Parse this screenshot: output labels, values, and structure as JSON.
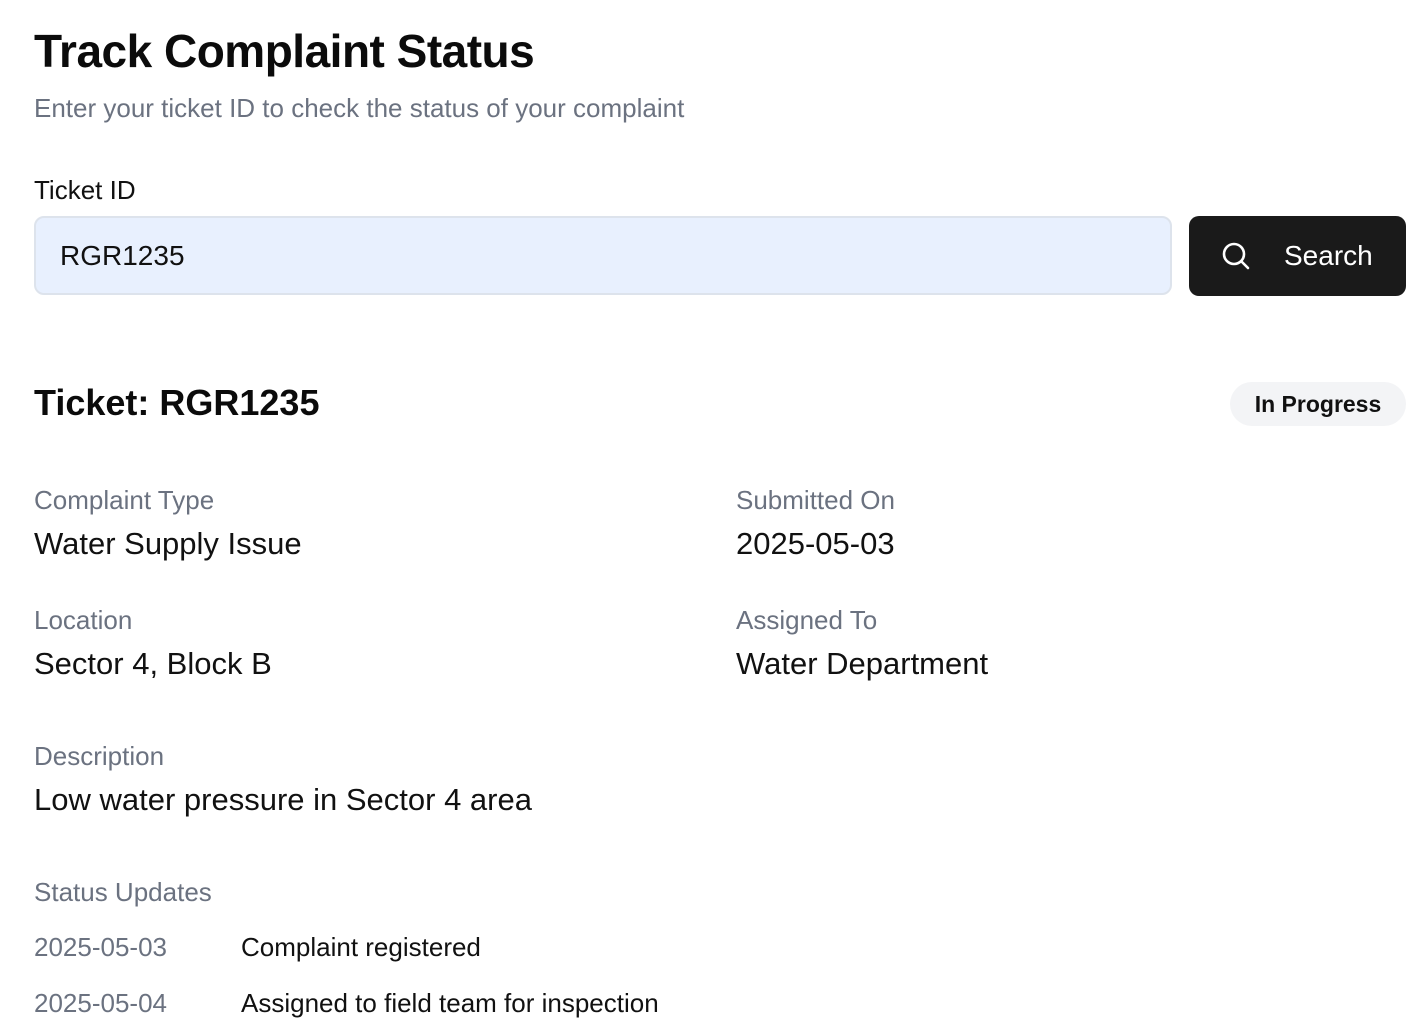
{
  "header": {
    "title": "Track Complaint Status",
    "subtitle": "Enter your ticket ID to check the status of your complaint"
  },
  "search": {
    "field_label": "Ticket ID",
    "value": "RGR1235",
    "button_label": "Search",
    "button_icon": "search-icon"
  },
  "ticket": {
    "heading": "Ticket: RGR1235",
    "status": "In Progress",
    "details": {
      "complaint_type": {
        "label": "Complaint Type",
        "value": "Water Supply Issue"
      },
      "submitted_on": {
        "label": "Submitted On",
        "value": "2025-05-03"
      },
      "location": {
        "label": "Location",
        "value": "Sector 4, Block B"
      },
      "assigned_to": {
        "label": "Assigned To",
        "value": "Water Department"
      },
      "description": {
        "label": "Description",
        "value": "Low water pressure in Sector 4 area"
      }
    },
    "updates_label": "Status Updates",
    "updates": [
      {
        "date": "2025-05-03",
        "text": "Complaint registered"
      },
      {
        "date": "2025-05-04",
        "text": "Assigned to field team for inspection"
      }
    ]
  },
  "colors": {
    "button_bg": "#1a1a1a",
    "input_bg": "#e8f0fe",
    "badge_bg": "#f3f4f6",
    "muted_text": "#6b7280"
  }
}
